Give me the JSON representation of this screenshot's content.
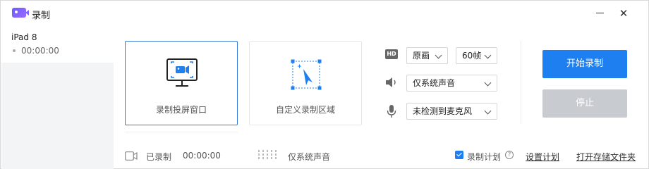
{
  "window": {
    "title": "录制"
  },
  "device": {
    "name": "iPad 8",
    "duration": "00:00:00"
  },
  "modes": [
    {
      "label": "录制投屏窗口",
      "icon": "screen-record-icon"
    },
    {
      "label": "自定义录制区域",
      "icon": "region-select-icon"
    }
  ],
  "settings": {
    "quality": {
      "icon": "hd-icon",
      "badge": "HD",
      "value": "原画"
    },
    "fps": {
      "value": "60帧"
    },
    "audio": {
      "icon": "speaker-icon",
      "value": "仅系统声音"
    },
    "mic": {
      "icon": "microphone-icon",
      "value": "未检测到麦克风"
    }
  },
  "actions": {
    "start": "开始录制",
    "stop": "停止"
  },
  "status": {
    "recorded_label": "已录制",
    "recorded_time": "00:00:00",
    "audio_source": "仅系统声音",
    "schedule_label": "录制计划",
    "schedule_checked": true,
    "set_schedule": "设置计划",
    "open_folder": "打开存储文件夹"
  },
  "colors": {
    "accent": "#1e7ff0",
    "active_border": "#3a7ad8",
    "disabled": "#c8cbd0"
  }
}
